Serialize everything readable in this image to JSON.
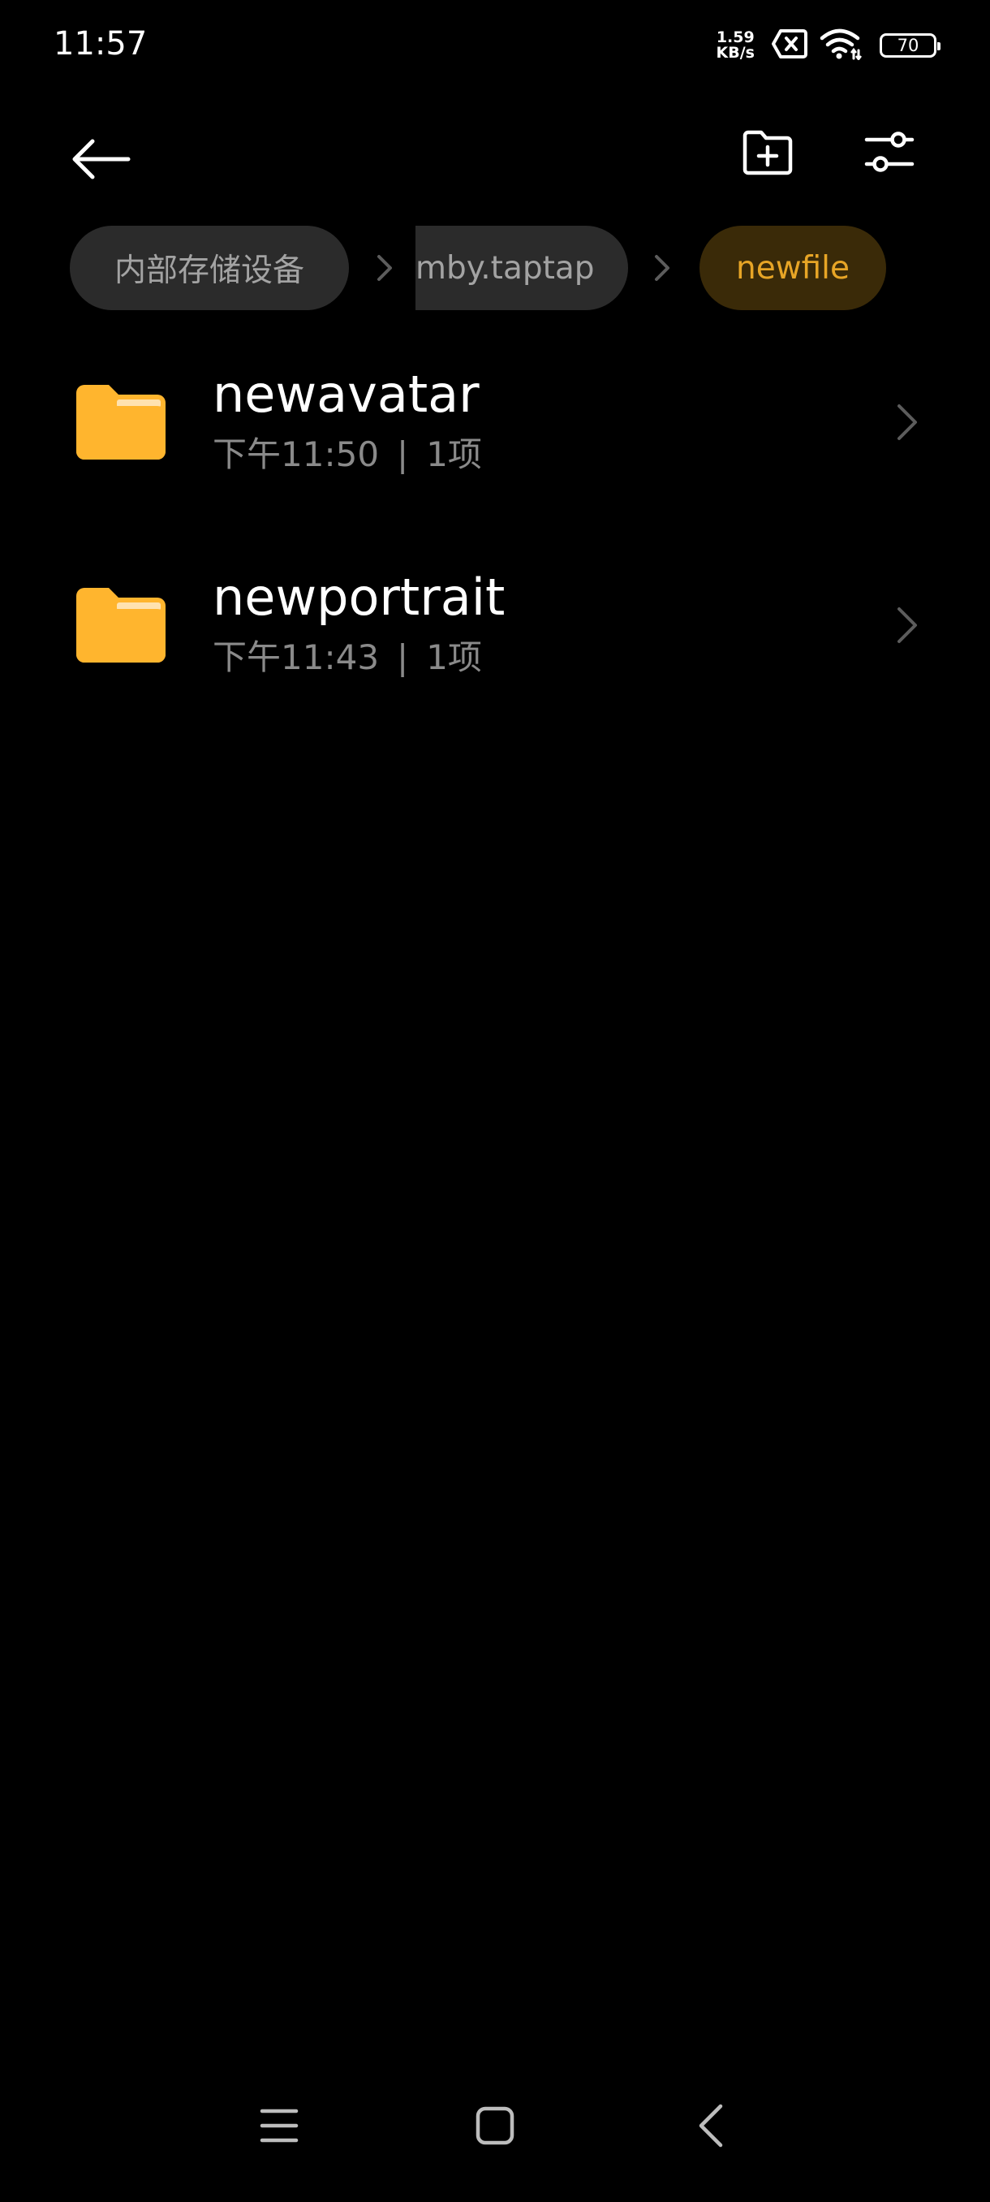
{
  "status_bar": {
    "time": "11:57",
    "net_speed_value": "1.59",
    "net_speed_unit": "KB/s",
    "battery_level": "70"
  },
  "toolbar": {
    "back_icon": "arrow-left-icon",
    "new_folder_icon": "folder-plus-icon",
    "filter_icon": "sliders-icon"
  },
  "breadcrumb": {
    "items": [
      {
        "label": "内部存储设备"
      },
      {
        "label": "mby.taptap"
      },
      {
        "label": "newfile"
      }
    ]
  },
  "files": [
    {
      "name": "newavatar",
      "time": "下午11:50",
      "separator": "|",
      "count": "1项"
    },
    {
      "name": "newportrait",
      "time": "下午11:43",
      "separator": "|",
      "count": "1项"
    }
  ],
  "colors": {
    "background": "#000000",
    "folder": "#ffb52e",
    "accent": "#e7a526",
    "crumb_bg": "#2b2b2b",
    "crumb_active_bg": "#3a2a08",
    "secondary_text": "#8a8a8a"
  }
}
